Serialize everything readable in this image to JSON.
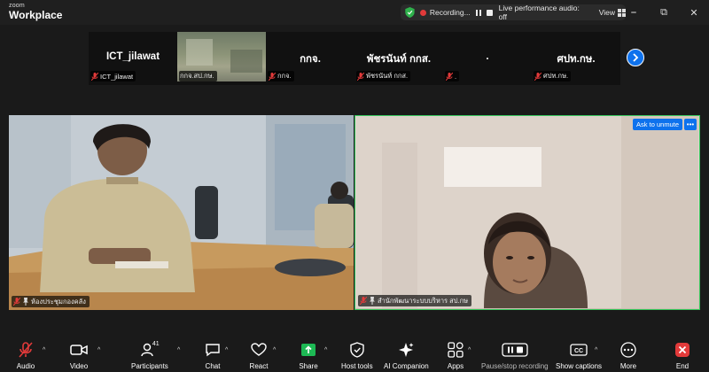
{
  "app": {
    "brand_small": "zoom",
    "brand_big": "Workplace"
  },
  "recording_bar": {
    "recording_text": "Recording...",
    "live_text": "Live performance audio: off",
    "view_label": "View"
  },
  "window_controls": {
    "minimize": "⎯",
    "maximize": "⧉",
    "close": "✕"
  },
  "gallery": [
    {
      "name": "ICT_jilawat",
      "label": "ICT_jilawat",
      "has_video": false
    },
    {
      "name": "",
      "label": "กกจ.สป.กษ.",
      "has_video": true
    },
    {
      "name": "กกจ.",
      "label": "กกจ.",
      "has_video": false
    },
    {
      "name": "พัชรนันท์ กกส.",
      "label": "พัชรนันท์ กกส.",
      "has_video": false
    },
    {
      "name": ".",
      "label": ".",
      "has_video": false
    },
    {
      "name": "ศปท.กษ.",
      "label": "ศปท.กษ.",
      "has_video": false
    }
  ],
  "panels": {
    "left_label": "ห้องประชุมกองคลัง",
    "right_label": "สำนักพัฒนาระบบบริหาร สป.กษ",
    "ask_unmute": "Ask to unmute",
    "more": "•••"
  },
  "toolbar": {
    "audio": "Audio",
    "video": "Video",
    "participants": "Participants",
    "participants_count": "41",
    "chat": "Chat",
    "react": "React",
    "share": "Share",
    "host_tools": "Host tools",
    "ai_companion": "AI Companion",
    "apps": "Apps",
    "pause_stop": "Pause/stop recording",
    "captions": "Show captions",
    "captions_cc": "CC",
    "more": "More",
    "end": "End"
  },
  "colors": {
    "accent_blue": "#0e72ed",
    "active_speaker_green": "#36c75c",
    "mute_red": "#e23a3a",
    "share_green": "#1db954",
    "background": "#1a1a1a"
  }
}
